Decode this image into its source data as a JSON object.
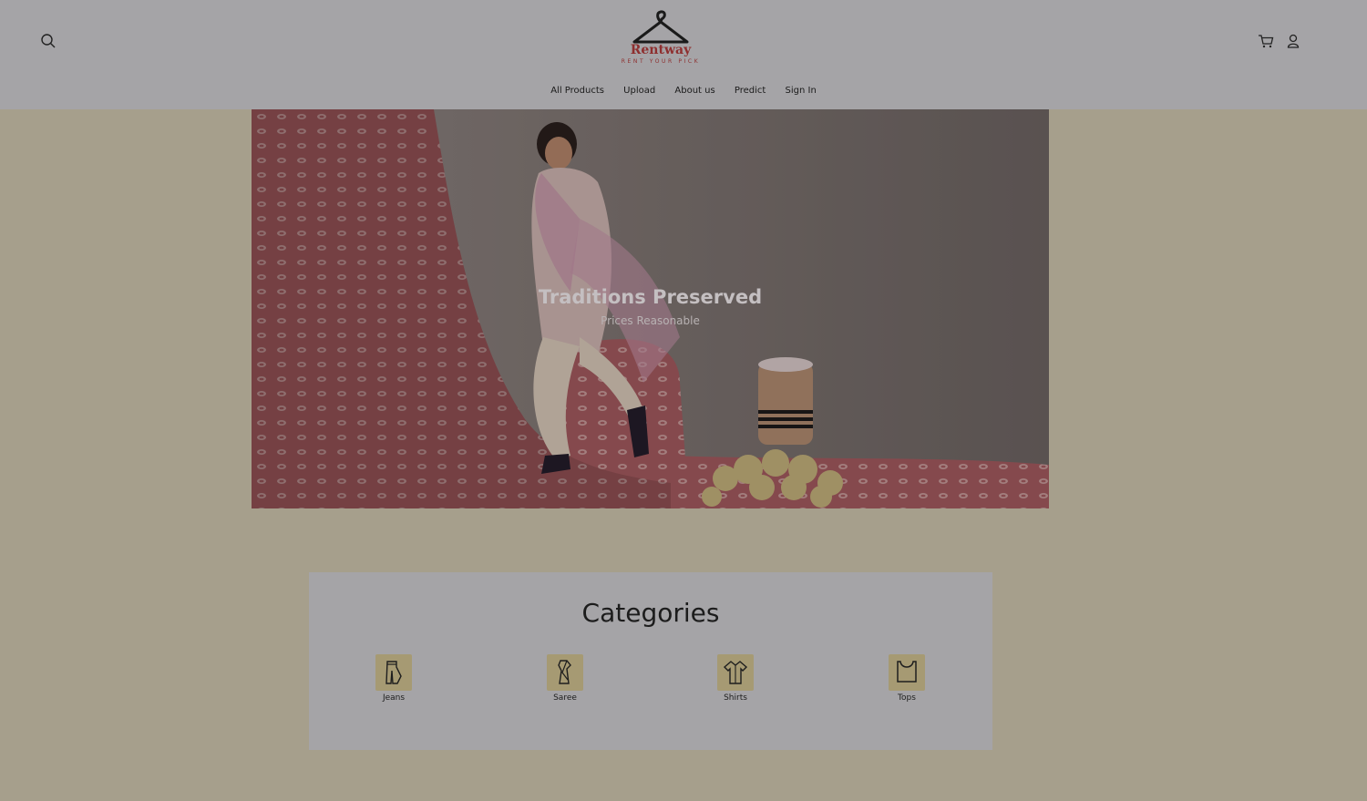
{
  "header": {
    "brand": "Rentway",
    "tagline": "RENT YOUR PICK",
    "icons": {
      "search": "search-icon",
      "cart": "cart-icon",
      "user": "user-icon"
    }
  },
  "nav": {
    "items": [
      {
        "label": "All Products"
      },
      {
        "label": "Upload"
      },
      {
        "label": "About us"
      },
      {
        "label": "Predict"
      },
      {
        "label": "Sign In"
      }
    ]
  },
  "hero": {
    "title": "Traditions Preserved",
    "subtitle": "Prices Reasonable"
  },
  "categories": {
    "title": "Categories",
    "items": [
      {
        "label": "Jeans",
        "icon": "jeans-icon"
      },
      {
        "label": "Saree",
        "icon": "saree-icon"
      },
      {
        "label": "Shirts",
        "icon": "shirt-icon"
      },
      {
        "label": "Tops",
        "icon": "top-icon"
      }
    ]
  },
  "colors": {
    "page_background": "#a69f8c",
    "header_background": "#a5a4a7",
    "brand": "#8e2f2f",
    "category_icon_bg": "#a69a73"
  }
}
